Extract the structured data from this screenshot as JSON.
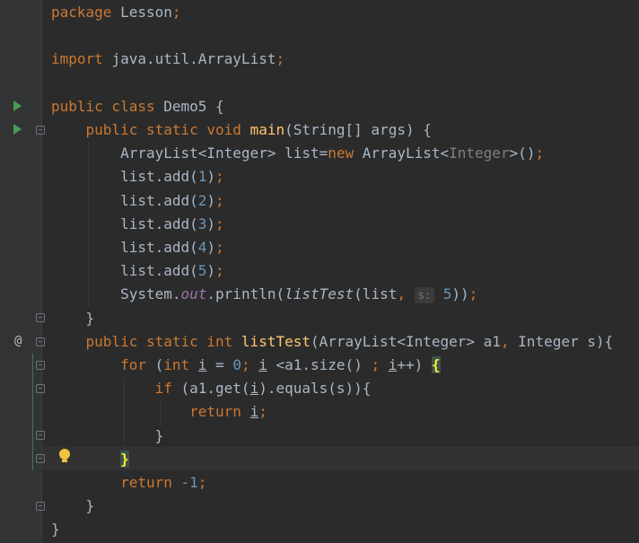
{
  "editor": {
    "lines": [
      {
        "tokens": [
          {
            "c": "kw",
            "t": "package "
          },
          {
            "c": "",
            "t": "Lesson"
          },
          {
            "c": "kw",
            "t": ";"
          }
        ]
      },
      {
        "tokens": []
      },
      {
        "tokens": [
          {
            "c": "kw",
            "t": "import "
          },
          {
            "c": "",
            "t": "java.util.ArrayList"
          },
          {
            "c": "kw",
            "t": ";"
          }
        ]
      },
      {
        "tokens": []
      },
      {
        "tokens": [
          {
            "c": "kw",
            "t": "public class "
          },
          {
            "c": "",
            "t": "Demo5 {"
          }
        ]
      },
      {
        "tokens": [
          {
            "c": "",
            "t": "    "
          },
          {
            "c": "kw",
            "t": "public static void "
          },
          {
            "c": "fn",
            "t": "main"
          },
          {
            "c": "",
            "t": "(String[] args) {"
          }
        ]
      },
      {
        "tokens": [
          {
            "c": "",
            "t": "        ArrayList<Integer> list="
          },
          {
            "c": "kw",
            "t": "new "
          },
          {
            "c": "",
            "t": "ArrayList<"
          },
          {
            "c": "typ",
            "t": "Integer"
          },
          {
            "c": "",
            "t": ">()"
          },
          {
            "c": "kw",
            "t": ";"
          }
        ]
      },
      {
        "tokens": [
          {
            "c": "",
            "t": "        list.add("
          },
          {
            "c": "num",
            "t": "1"
          },
          {
            "c": "",
            "t": ")"
          },
          {
            "c": "kw",
            "t": ";"
          }
        ]
      },
      {
        "tokens": [
          {
            "c": "",
            "t": "        list.add("
          },
          {
            "c": "num",
            "t": "2"
          },
          {
            "c": "",
            "t": ")"
          },
          {
            "c": "kw",
            "t": ";"
          }
        ]
      },
      {
        "tokens": [
          {
            "c": "",
            "t": "        list.add("
          },
          {
            "c": "num",
            "t": "3"
          },
          {
            "c": "",
            "t": ")"
          },
          {
            "c": "kw",
            "t": ";"
          }
        ]
      },
      {
        "tokens": [
          {
            "c": "",
            "t": "        list.add("
          },
          {
            "c": "num",
            "t": "4"
          },
          {
            "c": "",
            "t": ")"
          },
          {
            "c": "kw",
            "t": ";"
          }
        ]
      },
      {
        "tokens": [
          {
            "c": "",
            "t": "        list.add("
          },
          {
            "c": "num",
            "t": "5"
          },
          {
            "c": "",
            "t": ")"
          },
          {
            "c": "kw",
            "t": ";"
          }
        ]
      },
      {
        "tokens": [
          {
            "c": "",
            "t": "        System."
          },
          {
            "c": "it",
            "t": "out"
          },
          {
            "c": "",
            "t": ".println("
          },
          {
            "c": "itc",
            "t": "listTest"
          },
          {
            "c": "",
            "t": "(list"
          },
          {
            "c": "kw",
            "t": ", "
          },
          {
            "c": "hint",
            "t": "s:"
          },
          {
            "c": "num",
            "t": " 5"
          },
          {
            "c": "",
            "t": "))"
          },
          {
            "c": "kw",
            "t": ";"
          }
        ]
      },
      {
        "tokens": [
          {
            "c": "",
            "t": "    }"
          }
        ]
      },
      {
        "tokens": [
          {
            "c": "",
            "t": "    "
          },
          {
            "c": "kw",
            "t": "public static int "
          },
          {
            "c": "fn",
            "t": "listTest"
          },
          {
            "c": "",
            "t": "(ArrayList<Integer> a1"
          },
          {
            "c": "kw",
            "t": ", "
          },
          {
            "c": "",
            "t": "Integer s){"
          }
        ]
      },
      {
        "tokens": [
          {
            "c": "",
            "t": "        "
          },
          {
            "c": "kw",
            "t": "for "
          },
          {
            "c": "",
            "t": "("
          },
          {
            "c": "kw",
            "t": "int "
          },
          {
            "c": "ul",
            "t": "i"
          },
          {
            "c": "",
            "t": " = "
          },
          {
            "c": "num",
            "t": "0"
          },
          {
            "c": "kw",
            "t": "; "
          },
          {
            "c": "ul",
            "t": "i"
          },
          {
            "c": "",
            "t": " <a1.size() "
          },
          {
            "c": "kw",
            "t": "; "
          },
          {
            "c": "ul",
            "t": "i"
          },
          {
            "c": "",
            "t": "++) "
          },
          {
            "c": "brace-hl",
            "t": "{"
          }
        ]
      },
      {
        "tokens": [
          {
            "c": "",
            "t": "            "
          },
          {
            "c": "kw",
            "t": "if "
          },
          {
            "c": "",
            "t": "(a1.get("
          },
          {
            "c": "ul",
            "t": "i"
          },
          {
            "c": "",
            "t": ").equals(s)){"
          }
        ]
      },
      {
        "tokens": [
          {
            "c": "",
            "t": "                "
          },
          {
            "c": "kw",
            "t": "return "
          },
          {
            "c": "ul",
            "t": "i"
          },
          {
            "c": "kw",
            "t": ";"
          }
        ]
      },
      {
        "tokens": [
          {
            "c": "",
            "t": "            }"
          }
        ]
      },
      {
        "tokens": [
          {
            "c": "",
            "t": "        "
          },
          {
            "c": "brace-hl",
            "t": "}"
          }
        ]
      },
      {
        "tokens": [
          {
            "c": "",
            "t": "        "
          },
          {
            "c": "kw",
            "t": "return "
          },
          {
            "c": "num",
            "t": "-1"
          },
          {
            "c": "kw",
            "t": ";"
          }
        ]
      },
      {
        "tokens": [
          {
            "c": "",
            "t": "    }"
          }
        ]
      },
      {
        "tokens": [
          {
            "c": "",
            "t": "}"
          }
        ]
      }
    ]
  },
  "gutter": {
    "line_numbers": [
      "",
      "",
      "",
      "",
      "",
      "",
      "",
      "",
      "",
      "",
      "",
      "",
      "",
      "",
      "",
      "",
      "",
      "",
      "",
      "",
      "",
      "",
      ""
    ],
    "run_icons": [
      "run-class-icon",
      "run-main-icon"
    ],
    "override_marker": "@",
    "intention_icon": "lightbulb-icon"
  },
  "colors": {
    "background": "#2b2b2b",
    "keyword": "#cc7832",
    "function": "#ffc66d",
    "number": "#6897bb",
    "text": "#a9b7c6",
    "static_field": "#9876aa"
  }
}
